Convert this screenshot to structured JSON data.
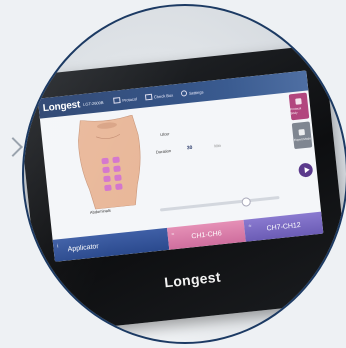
{
  "header": {
    "logo": "Longest",
    "model": "LGT-2600B",
    "nav": [
      {
        "label": "Protocol"
      },
      {
        "label": "Check Box"
      },
      {
        "label": "Settings"
      }
    ]
  },
  "body_map": {
    "region_label": "Abdominals"
  },
  "params": [
    {
      "label": "Ulcer",
      "value": ""
    },
    {
      "label": "Duration",
      "value": "30",
      "unit": "Min"
    }
  ],
  "side_buttons": [
    {
      "label": "Protocol Body"
    },
    {
      "label": "Expert Mode"
    }
  ],
  "tabs": [
    {
      "label": "Applicator"
    },
    {
      "label": "CH1-CH6"
    },
    {
      "label": "CH7-CH12"
    }
  ],
  "brand": "Longest",
  "colors": {
    "topbar": "#27406e",
    "tab_blue": "#2b4a8e",
    "tab_pink": "#cf6e9e",
    "tab_purple": "#6b5cb5",
    "play": "#5b3a8c",
    "side_magenta": "#b2467e"
  },
  "progress": {
    "value_fraction": 0.7
  }
}
